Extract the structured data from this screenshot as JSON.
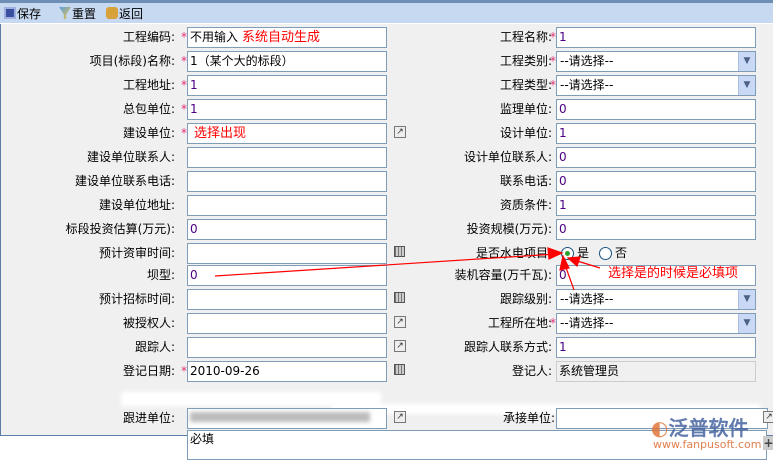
{
  "toolbar": {
    "save": "保存",
    "reset": "重置",
    "back": "返回"
  },
  "left": [
    {
      "label": "工程编码:",
      "req": true,
      "value": "不用输入",
      "note": "系统自动生成"
    },
    {
      "label": "项目(标段)名称:",
      "req": true,
      "value": "1（某个大的标段）"
    },
    {
      "label": "工程地址:",
      "req": true,
      "value": "1"
    },
    {
      "label": "总包单位:",
      "req": true,
      "value": "1"
    },
    {
      "label": "建设单位:",
      "req": true,
      "value": "",
      "note": "选择出现",
      "icon": "picker"
    },
    {
      "label": "建设单位联系人:",
      "value": ""
    },
    {
      "label": "建设单位联系电话:",
      "value": ""
    },
    {
      "label": "建设单位地址:",
      "value": ""
    },
    {
      "label": "标段投资估算(万元):",
      "value": "0"
    },
    {
      "label": "预计资审时间:",
      "value": "",
      "icon": "calendar"
    },
    {
      "label": "坝型:",
      "value": "0"
    },
    {
      "label": "预计招标时间:",
      "value": "",
      "icon": "calendar"
    },
    {
      "label": "被授权人:",
      "value": "",
      "icon": "picker"
    },
    {
      "label": "跟踪人:",
      "value": "",
      "icon": "picker"
    },
    {
      "label": "登记日期:",
      "req": true,
      "value": "2010-09-26",
      "icon": "calendar"
    }
  ],
  "right": [
    {
      "label": "工程名称:",
      "req": true,
      "value": "1"
    },
    {
      "label": "工程类别:",
      "req": true,
      "select": "--请选择--"
    },
    {
      "label": "工程类型:",
      "req": true,
      "select": "--请选择--"
    },
    {
      "label": "监理单位:",
      "value": "0"
    },
    {
      "label": "设计单位:",
      "value": "1"
    },
    {
      "label": "设计单位联系人:",
      "value": "0"
    },
    {
      "label": "联系电话:",
      "value": "0"
    },
    {
      "label": "资质条件:",
      "value": "1"
    },
    {
      "label": "投资规模(万元):",
      "value": "0"
    },
    {
      "label": "是否水电项目:",
      "radio": [
        "是",
        "否"
      ],
      "checked": 0
    },
    {
      "label": "装机容量(万千瓦):",
      "value": "0"
    },
    {
      "label": "跟踪级别:",
      "select": "--请选择--"
    },
    {
      "label": "工程所在地:",
      "req": true,
      "select": "--请选择--"
    },
    {
      "label": "跟踪人联系方式:",
      "value": "1"
    },
    {
      "label": "登记人:",
      "value": "系统管理员",
      "readonly": true
    }
  ],
  "bottom": {
    "follow_label": "跟进单位:",
    "follow_value": "",
    "undertake_label": "承接单位:",
    "undertake_value": "",
    "memo": "必填"
  },
  "annotation": "选择是的时候是必填项",
  "logo": {
    "name": "泛普软件",
    "url": "www.fanpusoft.com"
  }
}
